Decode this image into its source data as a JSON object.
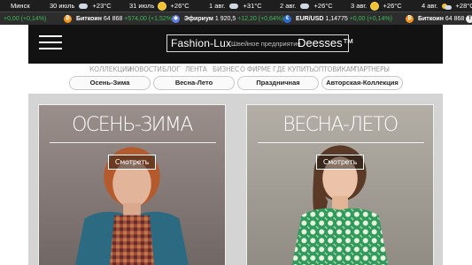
{
  "weather": {
    "city": "Минск",
    "days": [
      {
        "date": "30 июль",
        "icon": "cloud-icon",
        "temp": "+23°C"
      },
      {
        "date": "31 июль",
        "icon": "sun-icon",
        "temp": "+26°C"
      },
      {
        "date": "1 авг.",
        "icon": "cloud-icon",
        "temp": "+31°C"
      },
      {
        "date": "2 авг.",
        "icon": "cloud-icon",
        "temp": "+26°C"
      },
      {
        "date": "3 авг.",
        "icon": "sun-icon",
        "temp": "+26°C"
      },
      {
        "date": "4 авг.",
        "icon": "sun-cloud-icon",
        "temp": "+28°C"
      }
    ]
  },
  "ticker": {
    "lead_change": "+0,00 (+0,14%)",
    "items": [
      {
        "icon": "bitcoin-icon",
        "name": "Биткоин",
        "value": "64 868",
        "change": "+574,00 (+1,52%)"
      },
      {
        "icon": "ethereum-icon",
        "name": "Эфириум",
        "value": "1 920,5",
        "change": "+12,20 (+0,64%)"
      },
      {
        "icon": "eur-usd-icon",
        "name": "EUR/USD",
        "value": "1,14775",
        "change": "+0,00 (+0,14%)"
      },
      {
        "icon": "bitcoin-icon",
        "name": "Биткоин",
        "value": "64 868",
        "change": ""
      }
    ],
    "tail_badge": "T"
  },
  "header": {
    "logo_name": "Fashion-Lux",
    "logo_tagline": "Швейное предприятие",
    "logo_brand": "Deesses™"
  },
  "nav": {
    "items": [
      "Коллекции",
      "Новости",
      "Блог",
      "Лента",
      "Бизнес",
      "О фирме",
      "Где купить",
      "Оптовикам",
      "Партнеры"
    ]
  },
  "categories": {
    "items": [
      "Осень-Зима",
      "Весна-Лето",
      "Праздничная",
      "Авторская-Коллекция"
    ]
  },
  "cards": [
    {
      "title": "Осень-Зима",
      "button": "Смотреть"
    },
    {
      "title": "Весна-Лето",
      "button": "Смотреть"
    }
  ],
  "colors": {
    "header_bg": "#121212",
    "weather_bg": "#1e1e1e",
    "ticker_bg": "#2d2d2d",
    "positive_change": "#3dbb55",
    "main_bg": "#d4d4d4"
  }
}
